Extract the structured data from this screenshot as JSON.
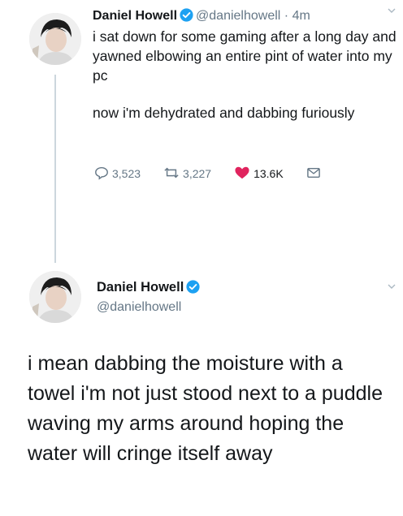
{
  "tweet1": {
    "name": "Daniel Howell",
    "handle": "@danielhowell",
    "time": "· 4m",
    "text_p1": "i sat down for some gaming after a long day and yawned elbowing an entire pint of water into my pc",
    "text_p2": "now i'm dehydrated and dabbing furiously",
    "replies": "3,523",
    "retweets": "3,227",
    "likes": "13.6K"
  },
  "tweet2": {
    "name": "Daniel Howell",
    "handle": "@danielhowell",
    "text": "i mean dabbing the moisture with a towel i'm not just stood next to a puddle waving my arms around hoping the water will cringe itself away"
  },
  "colors": {
    "verified": "#1da1f2",
    "like": "#e0245e",
    "secondary_text": "#657786",
    "thread_line": "#ccd6dd"
  },
  "icons": [
    "reply-icon",
    "retweet-icon",
    "heart-icon",
    "message-icon",
    "verified-badge-icon",
    "chevron-down-icon"
  ]
}
